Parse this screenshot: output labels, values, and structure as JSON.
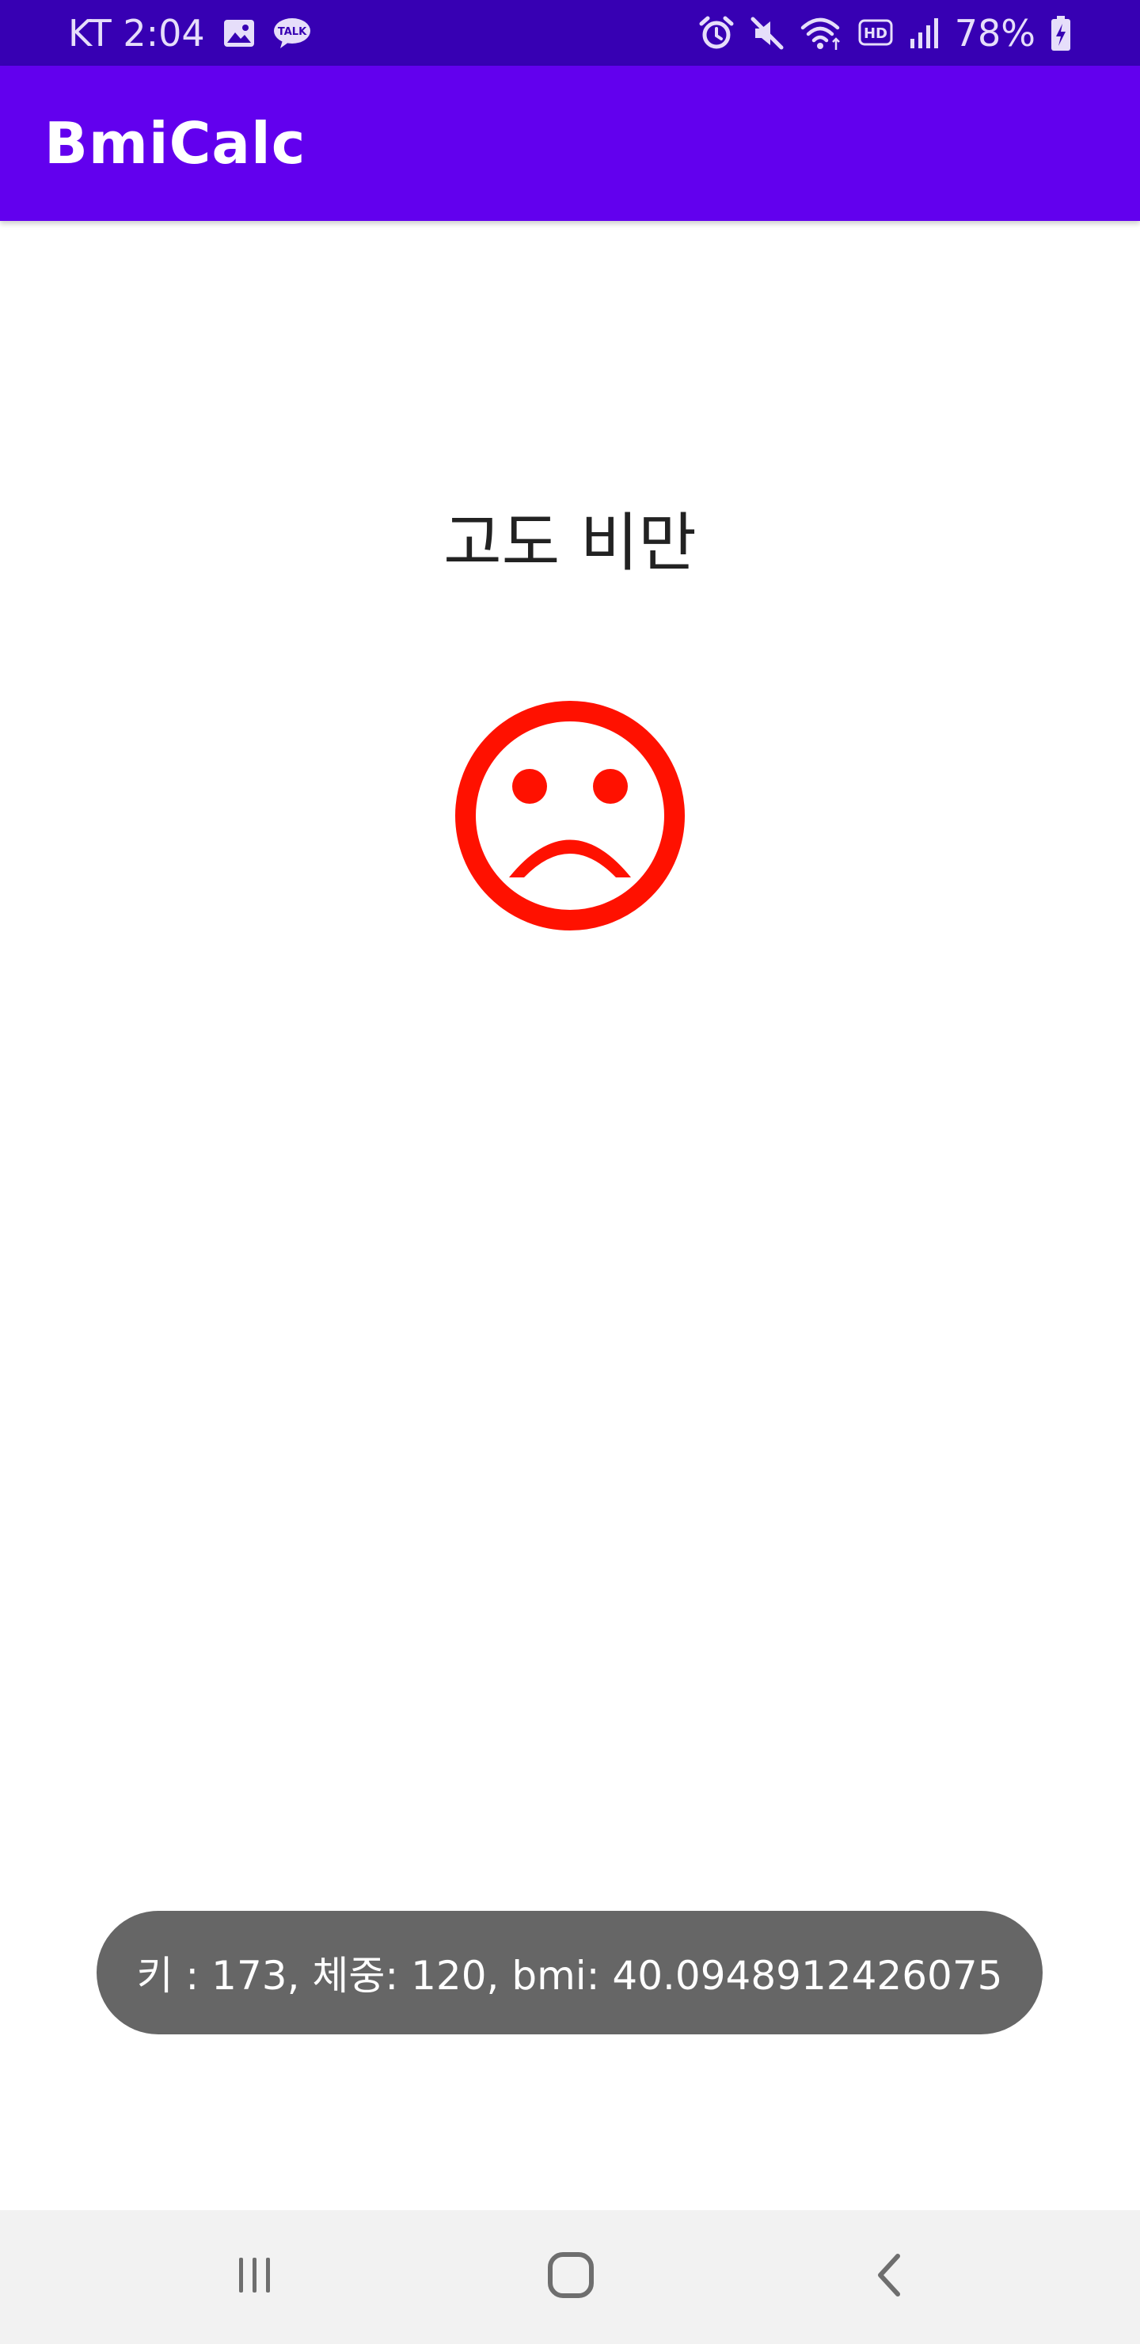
{
  "status_bar": {
    "carrier_time": "KT 2:04",
    "battery_percent": "78%",
    "icons": [
      "gallery-icon",
      "talk-icon",
      "alarm-icon",
      "mute-icon",
      "wifi-icon",
      "hd-icon",
      "signal-icon",
      "battery-charging-icon"
    ],
    "talk_badge": "TALK",
    "hd_badge": "HD"
  },
  "app_bar": {
    "title": "BmiCalc"
  },
  "result": {
    "label": "고도 비만",
    "face_icon": "sad-face-icon"
  },
  "toast": {
    "message": "키 : 173, 체중: 120, bmi: 40.0948912426075"
  },
  "nav_bar": {
    "icons": [
      "recent-apps-icon",
      "home-icon",
      "back-icon"
    ]
  },
  "colors": {
    "status_bar": "#3700b3",
    "app_bar": "#6200ee",
    "face": "#ff1100",
    "toast_bg": "#666666",
    "nav_bg": "#f2f2f2"
  }
}
